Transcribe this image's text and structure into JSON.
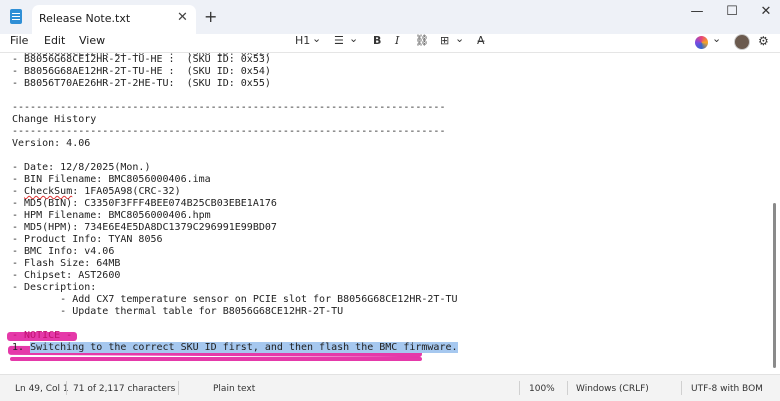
{
  "window": {
    "tab_title": "Release Note.txt",
    "tab_close": "✕",
    "new_tab": "+",
    "minimize": "—",
    "maximize": "☐",
    "close": "✕"
  },
  "menu": {
    "file": "File",
    "edit": "Edit",
    "view": "View"
  },
  "toolbar": {
    "heading": "H1",
    "heading_chevron": "⌄",
    "list": "☰",
    "list_chevron": "⌄",
    "bold": "B",
    "italic": "I",
    "link": "⛓",
    "table": "⊞",
    "table_chevron": "⌄",
    "clear_format": "A̶",
    "copilot_chevron": "⌄",
    "settings": "⚙"
  },
  "editor": {
    "lines": [
      "- B8056G68CE12HR-2T-TU-HE :  (SKU ID: 0x53)",
      "- B8056G68AE12HR-2T-TU-HE :  (SKU ID: 0x54)",
      "- B8056T70AE26HR-2T-2HE-TU:  (SKU ID: 0x55)",
      "",
      "------------------------------------------------------------------------",
      "Change History",
      "------------------------------------------------------------------------",
      "Version: 4.06",
      "",
      "- Date: 12/8/2025(Mon.)",
      "- BIN Filename: BMC8056000406.ima",
      "CheckSum",
      "- MD5(BIN): C3350F3FFF4BEE074B25CB03EBE1A176",
      "- HPM Filename: BMC8056000406.hpm",
      "- MD5(HPM): 734E6E4E5DA8DC1379C296991E99BD07",
      "- Product Info: TYAN 8056",
      "- BMC Info: v4.06",
      "- Flash Size: 64MB",
      "- Chipset: AST2600",
      "- Description:",
      "        - Add CX7 temperature sensor on PCIE slot for B8056G68CE12HR-2T-TU",
      "        - Update thermal table for B8056G68CE12HR-2T-TU",
      "",
      "- NOTICE -",
      "1. Switching to the correct SKU ID first, and then flash the BMC firmware."
    ],
    "checksum_prefix": "- ",
    "checksum_word": "CheckSum",
    "checksum_rest": ": 1FA05A98(CRC-32)",
    "notice_prefix": "1. ",
    "notice_text": "Switching to the correct SKU ID first, and then flash the BMC firmware."
  },
  "status": {
    "position": "Ln 49, Col 1",
    "chars": "71 of 2,117 characters",
    "format": "Plain text",
    "zoom": "100%",
    "line_ending": "Windows (CRLF)",
    "encoding": "UTF-8 with BOM"
  },
  "colors": {
    "highlight": "#e0169a",
    "selection": "#a6c8ef"
  }
}
